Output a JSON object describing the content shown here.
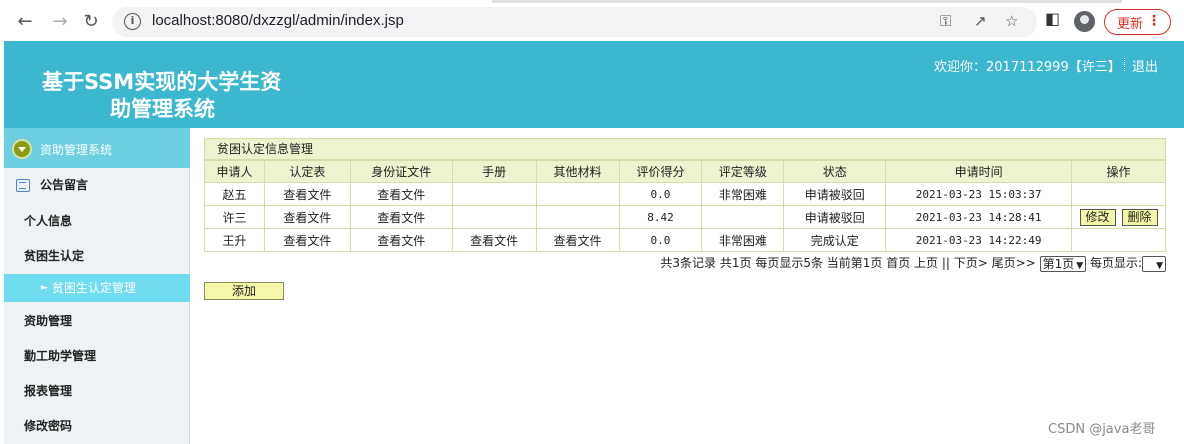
{
  "browser": {
    "url": "localhost:8080/dxzzgl/admin/index.jsp",
    "update_label": "更新"
  },
  "header": {
    "title_line1": "基于SSM实现的大学生资",
    "title_line2": "助管理系统",
    "welcome": "欢迎你：2017112999【许三】",
    "logout": "退出"
  },
  "sidebar": {
    "head": "资助管理系统",
    "items": [
      "公告留言",
      "个人信息",
      "贫困生认定",
      "资助管理",
      "勤工助学管理",
      "报表管理",
      "修改密码"
    ],
    "active_sub": "贫困生认定管理"
  },
  "panel": {
    "title": "贫困认定信息管理",
    "columns": [
      "申请人",
      "认定表",
      "身份证文件",
      "手册",
      "其他材料",
      "评价得分",
      "评定等级",
      "状态",
      "申请时间",
      "操作"
    ],
    "rows": [
      {
        "applicant": "赵五",
        "form": "查看文件",
        "idfile": "查看文件",
        "manual": "",
        "other": "",
        "score": "0.0",
        "level": "非常困难",
        "status": "申请被驳回",
        "time": "2021-03-23 15:03:37",
        "edit": "",
        "delete": ""
      },
      {
        "applicant": "许三",
        "form": "查看文件",
        "idfile": "查看文件",
        "manual": "",
        "other": "",
        "score": "8.42",
        "level": "",
        "status": "申请被驳回",
        "time": "2021-03-23 14:28:41",
        "edit": "修改",
        "delete": "删除"
      },
      {
        "applicant": "王升",
        "form": "查看文件",
        "idfile": "查看文件",
        "manual": "查看文件",
        "other": "查看文件",
        "score": "0.0",
        "level": "非常困难",
        "status": "完成认定",
        "time": "2021-03-23 14:22:49",
        "edit": "",
        "delete": ""
      }
    ],
    "pager": {
      "summary": "共3条记录  共1页  每页显示5条  当前第1页  首页  上页  || 下页>  尾页>>",
      "page_select": "第1页",
      "per_page_label": "每页显示:"
    },
    "add_label": "添加"
  },
  "watermark": "CSDN @java老哥"
}
